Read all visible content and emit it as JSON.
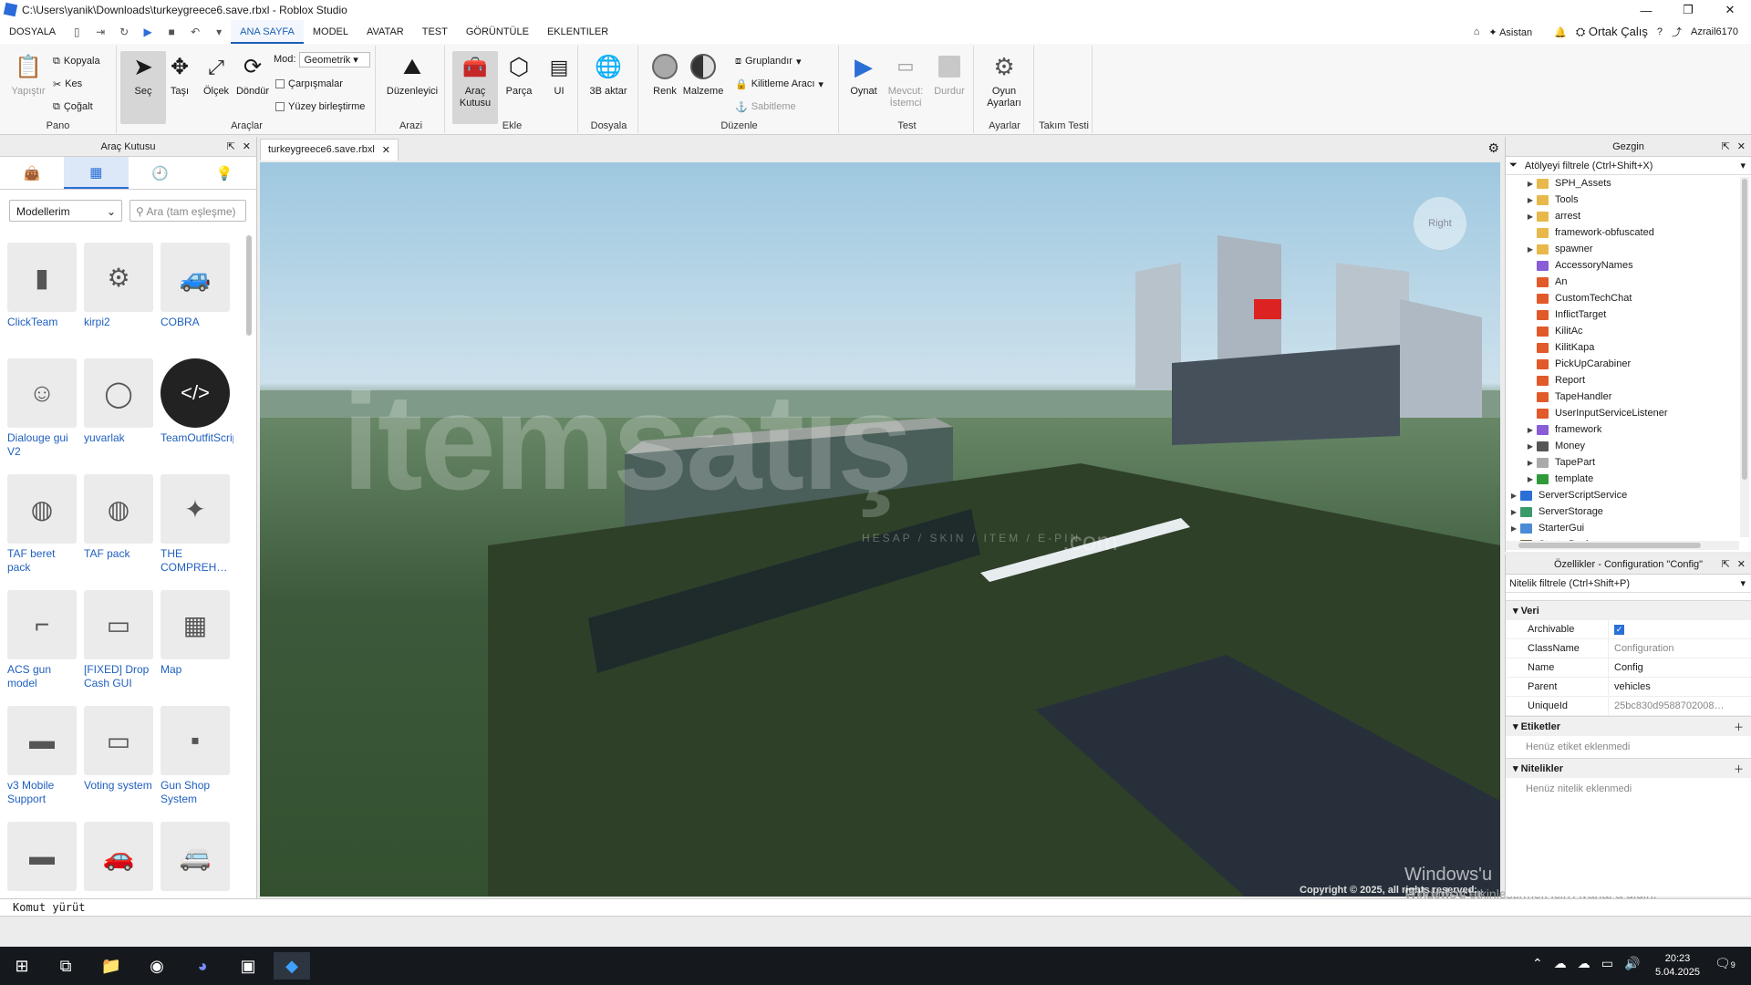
{
  "window": {
    "title": "C:\\Users\\yanik\\Downloads\\turkeygreece6.save.rbxl - Roblox Studio"
  },
  "menu": {
    "items": [
      "DOSYALA",
      "ANA SAYFA",
      "MODEL",
      "AVATAR",
      "TEST",
      "GÖRÜNTÜLE",
      "EKLENTILER"
    ],
    "active": "ANA SAYFA",
    "asistan": "Asistan",
    "collab": "Ortak Çalış",
    "user": "Azrail6170"
  },
  "ribbon": {
    "pano": {
      "label": "Pano",
      "paste": "Yapıştır",
      "copy": "Kopyala",
      "cut": "Kes",
      "dup": "Çoğalt"
    },
    "araclar": {
      "label": "Araçlar",
      "select": "Seç",
      "move": "Taşı",
      "scale": "Ölçek",
      "rotate": "Döndür",
      "mode_label": "Mod:",
      "mode_value": "Geometrik",
      "collisions": "Çarpışmalar",
      "join": "Yüzey birleştirme"
    },
    "arazi": {
      "label": "Arazi",
      "editor": "Düzenleyici"
    },
    "ekle": {
      "label": "Ekle",
      "toolbox": "Araç Kutusu",
      "part": "Parça",
      "ui": "UI"
    },
    "dosya": {
      "label": "Dosyala",
      "import3d": "3B aktar"
    },
    "duzenle": {
      "label": "Düzenle",
      "color": "Renk",
      "material": "Malzeme",
      "group": "Gruplandır",
      "lock": "Kilitleme Aracı",
      "anchor": "Sabitleme"
    },
    "test": {
      "label": "Test",
      "play": "Oynat",
      "current": "Mevcut: İstemci",
      "stop": "Durdur"
    },
    "ayarlar": {
      "label": "Ayarlar",
      "game": "Oyun Ayarları"
    },
    "takim": {
      "label": "Takım Testi"
    }
  },
  "toolbox": {
    "title": "Araç Kutusu",
    "category": "Modellerim",
    "search_placeholder": "Ara (tam eşleşme)",
    "items": [
      "ClickTeam",
      "kirpi2",
      "COBRA",
      "Dialouge gui V2",
      "yuvarlak",
      "TeamOutfitScript",
      "TAF beret pack",
      "TAF pack",
      "THE COMPREH…",
      "ACS gun model",
      "[FIXED] Drop Cash GUI",
      "Map",
      "v3 Mobile Support",
      "Voting system",
      "Gun Shop System",
      "",
      "",
      ""
    ]
  },
  "document": {
    "tab": "turkeygreece6.save.rbxl"
  },
  "viewport": {
    "watermark": "itemsatış",
    "watermark_sub": "HESAP / SKIN / ITEM / E-PIN",
    "watermark_com": ".com",
    "copyright": "Copyright © 2025, all rights reserved.",
    "activate_title": "Windows'u Etkinleştir",
    "activate_sub": "Windows'u etkinleştirmek için Ayarlar'a gidin.",
    "cube": "Right"
  },
  "explorer": {
    "title": "Gezgin",
    "filter": "Atölyeyi filtrele (Ctrl+Shift+X)",
    "items": [
      {
        "name": "SPH_Assets",
        "icon": "folder",
        "depth": 2
      },
      {
        "name": "Tools",
        "icon": "folder",
        "depth": 2
      },
      {
        "name": "arrest",
        "icon": "folder",
        "depth": 2
      },
      {
        "name": "framework-obfuscated",
        "icon": "folder",
        "depth": 2
      },
      {
        "name": "spawner",
        "icon": "folder",
        "depth": 2
      },
      {
        "name": "AccessoryNames",
        "icon": "module",
        "depth": 2
      },
      {
        "name": "An",
        "icon": "remote",
        "depth": 2
      },
      {
        "name": "CustomTechChat",
        "icon": "remote",
        "depth": 2
      },
      {
        "name": "InflictTarget",
        "icon": "remote",
        "depth": 2
      },
      {
        "name": "KilitAc",
        "icon": "remote",
        "depth": 2
      },
      {
        "name": "KilitKapa",
        "icon": "remote",
        "depth": 2
      },
      {
        "name": "PickUpCarabiner",
        "icon": "remote",
        "depth": 2
      },
      {
        "name": "Report",
        "icon": "remote",
        "depth": 2
      },
      {
        "name": "TapeHandler",
        "icon": "remote",
        "depth": 2
      },
      {
        "name": "UserInputServiceListener",
        "icon": "remote",
        "depth": 2
      },
      {
        "name": "framework",
        "icon": "module",
        "depth": 2
      },
      {
        "name": "Money",
        "icon": "globe",
        "depth": 2
      },
      {
        "name": "TapePart",
        "icon": "part",
        "depth": 2
      },
      {
        "name": "template",
        "icon": "value",
        "depth": 2
      },
      {
        "name": "ServerScriptService",
        "icon": "service",
        "depth": 1
      },
      {
        "name": "ServerStorage",
        "icon": "storage",
        "depth": 1
      },
      {
        "name": "StarterGui",
        "icon": "gui",
        "depth": 1
      },
      {
        "name": "StarterPack",
        "icon": "pack",
        "depth": 1
      }
    ]
  },
  "properties": {
    "title": "Özellikler - Configuration \"Config\"",
    "filter": "Nitelik filtrele (Ctrl+Shift+P)",
    "data_section": "Veri",
    "rows": [
      {
        "key": "Archivable",
        "value": ""
      },
      {
        "key": "ClassName",
        "value": "Configuration"
      },
      {
        "key": "Name",
        "value": "Config"
      },
      {
        "key": "Parent",
        "value": "vehicles"
      },
      {
        "key": "UniqueId",
        "value": "25bc830d9588702008…"
      }
    ],
    "tags_section": "Etiketler",
    "tags_empty": "Henüz etiket eklenmedi",
    "attrs_section": "Nitelikler",
    "attrs_empty": "Henüz nitelik eklenmedi"
  },
  "command": {
    "placeholder": "Komut yürüt"
  },
  "taskbar": {
    "time": "20:23",
    "date": "5.04.2025",
    "notif": "9"
  }
}
